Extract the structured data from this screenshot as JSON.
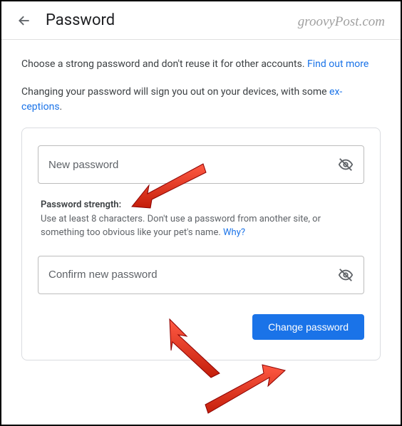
{
  "header": {
    "title": "Password"
  },
  "watermark": "groovyPost.com",
  "intro": {
    "line1_prefix": "Choose a strong password and don't reuse it for other accounts. ",
    "line1_link": "Find out more",
    "line2_prefix": "Changing your password will sign you out on your devices, with some ",
    "line2_link": "ex-ceptions",
    "line2_suffix": "."
  },
  "form": {
    "new_password_placeholder": "New password",
    "confirm_password_placeholder": "Confirm new password",
    "strength_title": "Password strength:",
    "strength_text": "Use at least 8 characters. Don't use a password from another site, or something too obvious like your pet's name. ",
    "strength_link": "Why?",
    "submit_label": "Change password"
  }
}
